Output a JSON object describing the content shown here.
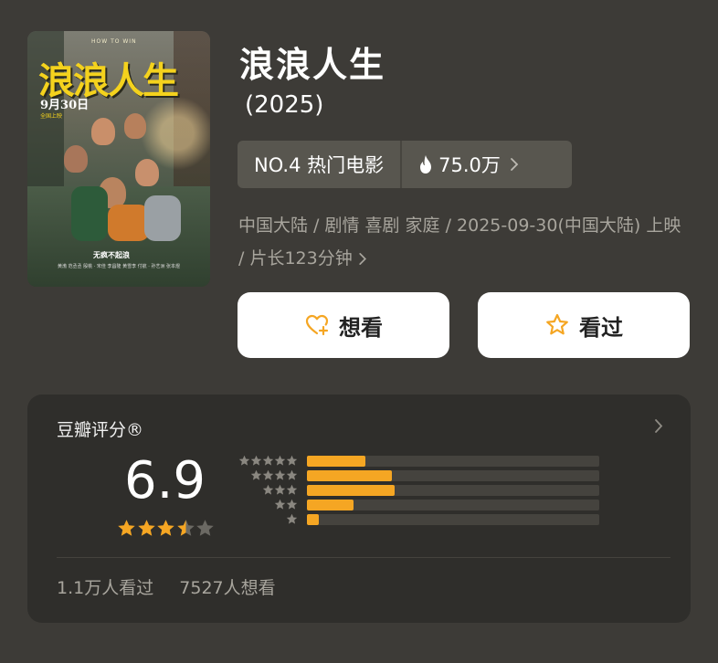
{
  "movie": {
    "title": "浪浪人生",
    "year": "(2025)",
    "rank_label": "NO.4 热门电影",
    "heat": "75.0万",
    "meta": "中国大陆 / 剧情 喜剧 家庭 / 2025-09-30(中国大陆) 上映 / 片长123分钟"
  },
  "poster": {
    "title": "浪浪人生",
    "top_text": "HOW TO WIN",
    "date": "9月30日",
    "date_sub": "全国上映",
    "tagline": "无疯不起浪",
    "credits": "黄渤 范丞丞 殷桃 · 宋佳 李昌隆 黄雪李 付航 · 孙艺洲 张本煜"
  },
  "actions": {
    "want_label": "想看",
    "seen_label": "看过"
  },
  "rating": {
    "section_title": "豆瓣评分®",
    "score": "6.9",
    "score_stars": 3.5,
    "distribution": [
      {
        "stars": 5,
        "percent": 20
      },
      {
        "stars": 4,
        "percent": 29
      },
      {
        "stars": 3,
        "percent": 30
      },
      {
        "stars": 2,
        "percent": 16
      },
      {
        "stars": 1,
        "percent": 4
      }
    ],
    "watched": "1.1万人看过",
    "want": "7527人想看"
  },
  "colors": {
    "background": "#3d3b37",
    "panel": "#2f2e2b",
    "accent_star": "#f5a623",
    "chip": "#58564f"
  },
  "icons": [
    "flame-icon",
    "chevron-right-icon",
    "heart-plus-icon",
    "star-outline-icon",
    "star-icon"
  ]
}
